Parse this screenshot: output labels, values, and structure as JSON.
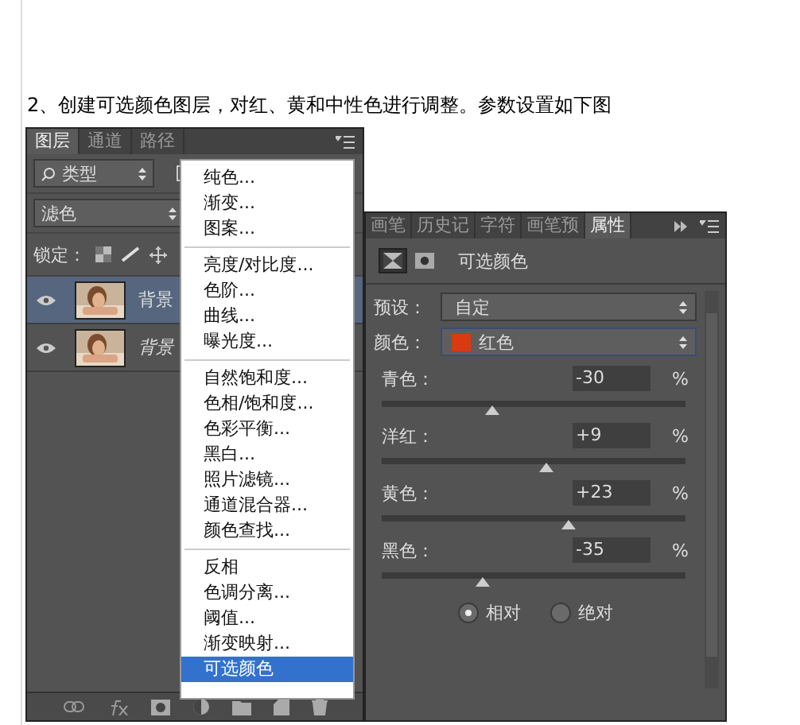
{
  "article": {
    "heading": "2、创建可选颜色图层，对红、黄和中性色进行调整。参数设置如下图"
  },
  "layers_panel": {
    "tabs": [
      {
        "label": "图层",
        "selected": true
      },
      {
        "label": "通道",
        "selected": false
      },
      {
        "label": "路径",
        "selected": false
      }
    ],
    "filter": {
      "value": "类型"
    },
    "blend_mode": {
      "value": "滤色"
    },
    "lock_label": "锁定：",
    "layers": [
      {
        "name": "背景",
        "kind": "layer",
        "selected": true
      },
      {
        "name": "背景",
        "kind": "background",
        "selected": false
      }
    ]
  },
  "adjustment_menu": {
    "groups": [
      [
        {
          "label": "纯色...",
          "selected": false
        },
        {
          "label": "渐变...",
          "selected": false
        },
        {
          "label": "图案...",
          "selected": false
        }
      ],
      [
        {
          "label": "亮度/对比度...",
          "selected": false
        },
        {
          "label": "色阶...",
          "selected": false
        },
        {
          "label": "曲线...",
          "selected": false
        },
        {
          "label": "曝光度...",
          "selected": false
        }
      ],
      [
        {
          "label": "自然饱和度...",
          "selected": false
        },
        {
          "label": "色相/饱和度...",
          "selected": false
        },
        {
          "label": "色彩平衡...",
          "selected": false
        },
        {
          "label": "黑白...",
          "selected": false
        },
        {
          "label": "照片滤镜...",
          "selected": false
        },
        {
          "label": "通道混合器...",
          "selected": false
        },
        {
          "label": "颜色查找...",
          "selected": false
        }
      ],
      [
        {
          "label": "反相",
          "selected": false
        },
        {
          "label": "色调分离...",
          "selected": false
        },
        {
          "label": "阈值...",
          "selected": false
        },
        {
          "label": "渐变映射...",
          "selected": false
        },
        {
          "label": "可选颜色",
          "selected": true
        }
      ]
    ]
  },
  "properties_panel": {
    "tabs": [
      {
        "label": "画笔",
        "selected": false
      },
      {
        "label": "历史记",
        "selected": false
      },
      {
        "label": "字符",
        "selected": false
      },
      {
        "label": "画笔预",
        "selected": false
      },
      {
        "label": "属性",
        "selected": true
      }
    ],
    "title": "可选颜色",
    "preset": {
      "label": "预设：",
      "value": "自定"
    },
    "color": {
      "label": "颜色：",
      "value": "红色",
      "color": "#d93a10"
    },
    "sliders": [
      {
        "label": "青色：",
        "value": "-30",
        "unit": "%",
        "level": 0.36
      },
      {
        "label": "洋红：",
        "value": "+9",
        "unit": "%",
        "level": 0.54
      },
      {
        "label": "黄色：",
        "value": "+23",
        "unit": "%",
        "level": 0.61
      },
      {
        "label": "黑色：",
        "value": "-35",
        "unit": "%",
        "level": 0.33
      }
    ],
    "radios": [
      {
        "label": "相对",
        "selected": true
      },
      {
        "label": "绝对",
        "selected": false
      }
    ]
  }
}
